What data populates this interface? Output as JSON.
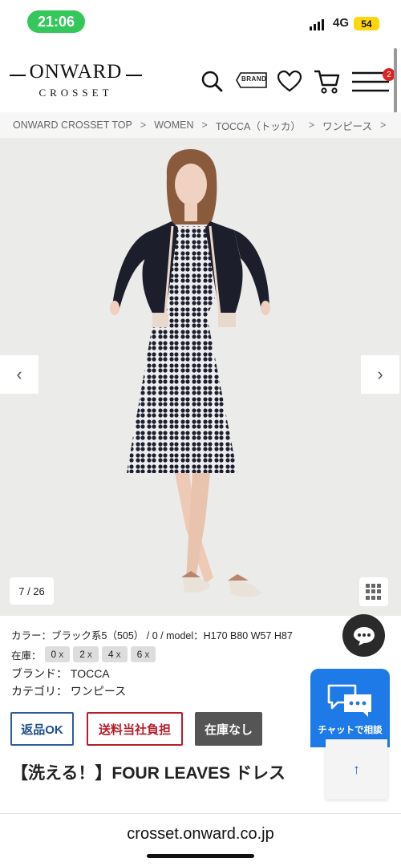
{
  "status_bar": {
    "time": "21:06",
    "network": "4G",
    "battery": "54"
  },
  "header": {
    "logo_main": "ONWARD",
    "logo_sub": "CROSSET",
    "brand_tag": "BRAND",
    "cart_count": "2",
    "icons": [
      "search-icon",
      "brand-tag-icon",
      "heart-icon",
      "cart-icon",
      "menu-icon"
    ]
  },
  "breadcrumb": {
    "items": [
      "ONWARD CROSSET TOP",
      "WOMEN",
      "TOCCA（トッカ）",
      "ワンピース"
    ],
    "separator": ">"
  },
  "gallery": {
    "counter": "7 / 26",
    "prev": "‹",
    "next": "›"
  },
  "product": {
    "color_line": "カラー：ブラック系5（505）  /  0  /  model：H170 B80 W57 H87",
    "stock_label": "在庫：",
    "sizes": [
      {
        "size": "0",
        "mark": "X"
      },
      {
        "size": "2",
        "mark": "X"
      },
      {
        "size": "4",
        "mark": "X"
      },
      {
        "size": "6",
        "mark": "X"
      }
    ],
    "brand_label": "ブランド：",
    "brand_value": "TOCCA",
    "category_label": "カテゴリ：",
    "category_value": "ワンピース",
    "tags": {
      "return": "返品OK",
      "shipping": "送料当社負担",
      "stock": "在庫なし"
    },
    "title": "【洗える！】FOUR LEAVES ドレス"
  },
  "chat": {
    "label": "チャットで相談",
    "scroll_top": "↑"
  },
  "browser": {
    "url": "crosset.onward.co.jp"
  }
}
